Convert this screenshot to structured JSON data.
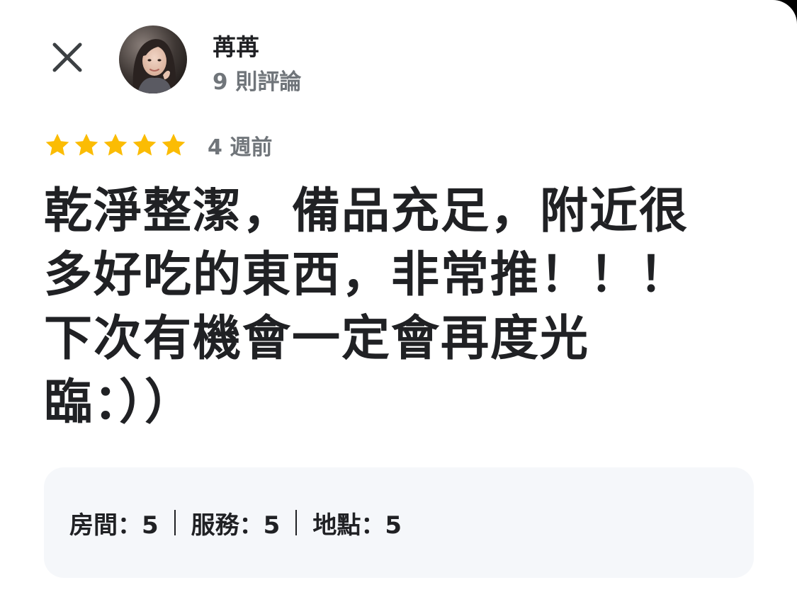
{
  "header": {
    "close_icon": "close-icon",
    "reviewer_name": "苒苒",
    "review_count": "9 則評論"
  },
  "rating": {
    "stars": 5,
    "max_stars": 5,
    "star_color": "#fbbc04",
    "time_ago": "4 週前"
  },
  "review": {
    "lines": [
      "乾淨整潔，備品充足，附近很",
      "多好吃的東西，非常推！！！",
      "下次有機會一定會再度光",
      "臨：））"
    ]
  },
  "sub_ratings": [
    {
      "text": "房間：5"
    },
    {
      "text": "服務：5"
    },
    {
      "text": "地點：5"
    }
  ],
  "colors": {
    "primary_text": "#202124",
    "secondary_text": "#70757a",
    "panel_bg": "#f5f7fa"
  }
}
